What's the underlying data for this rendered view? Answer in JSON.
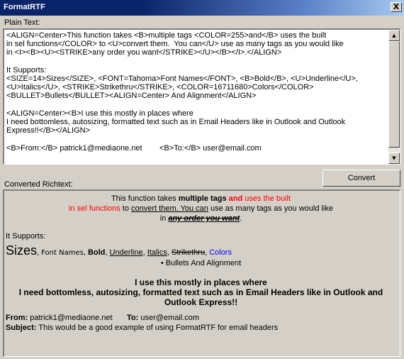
{
  "window": {
    "title": "FormatRTF",
    "close_glyph": "X"
  },
  "labels": {
    "plain_text": "Plain Text:",
    "converted": "Converted Richtext:"
  },
  "plain": {
    "lines": [
      "<ALIGN=Center>This function takes <B>multiple tags <COLOR=255>and</B> uses the built",
      "in sel functions</COLOR> to <U>convert them.  You can</U> use as many tags as you would like",
      "in <I><B><U><STRIKE>any order you want</STRIKE></U></B></I>.</ALIGN>",
      "",
      "It Supports:",
      "<SIZE=14>Sizes</SIZE>, <FONT=Tahoma>Font Names</FONT>, <B>Bold</B>, <U>Underline</U>,",
      "<U>Italics</U>, <STRIKE>Strikethru</STRIKE>, <COLOR=16711680>Colors</COLOR>",
      "<BULLET>Bullets</BULLET><ALIGN=Center> And Alignment</ALIGN>",
      "",
      "<ALIGN=Center><B>I use this mostly in places where",
      "I need bottomless, autosizing, formatted text such as in Email Headers like in Outlook and Outlook",
      "Express!!</B></ALIGN>",
      "",
      "<B>From:</B> patrick1@mediaone.net        <B>To:</B> user@email.com"
    ]
  },
  "button": {
    "convert": "Convert"
  },
  "rich": {
    "l1_a": "This function takes ",
    "l1_b": "multiple tags ",
    "l1_c": "and",
    "l1_d": " uses the built",
    "l2_a": "in sel functions",
    "l2_b": " to ",
    "l2_c": "convert them.  You can",
    "l2_d": " use as many tags as you would like",
    "l3_a": "in ",
    "l3_b": "any order you want",
    "l3_c": ".",
    "supports": "It Supports:",
    "sizes": "Sizes",
    "sep1": ", ",
    "font_names": "Font Names",
    "sep2": ", ",
    "bold": "Bold",
    "sep3": ", ",
    "underline": "Underline",
    "sep4": ", ",
    "italics": "Italics",
    "sep5": ", ",
    "strike": "Strikethru",
    "sep6": ", ",
    "colors": "Colors",
    "bullet_glyph": "•",
    "bullets_text": " Bullets And Alignment",
    "b1": "I use this mostly in places where",
    "b2": "I need bottomless, autosizing, formatted text such as in Email Headers like in Outlook and Outlook Express!!",
    "from_label": "From:",
    "from_value": " patrick1@mediaone.net",
    "to_label": "To:",
    "to_value": " user@email.com",
    "subject_label": "Subject:",
    "subject_value": " This would be a good example of using FormatRTF for email headers"
  }
}
